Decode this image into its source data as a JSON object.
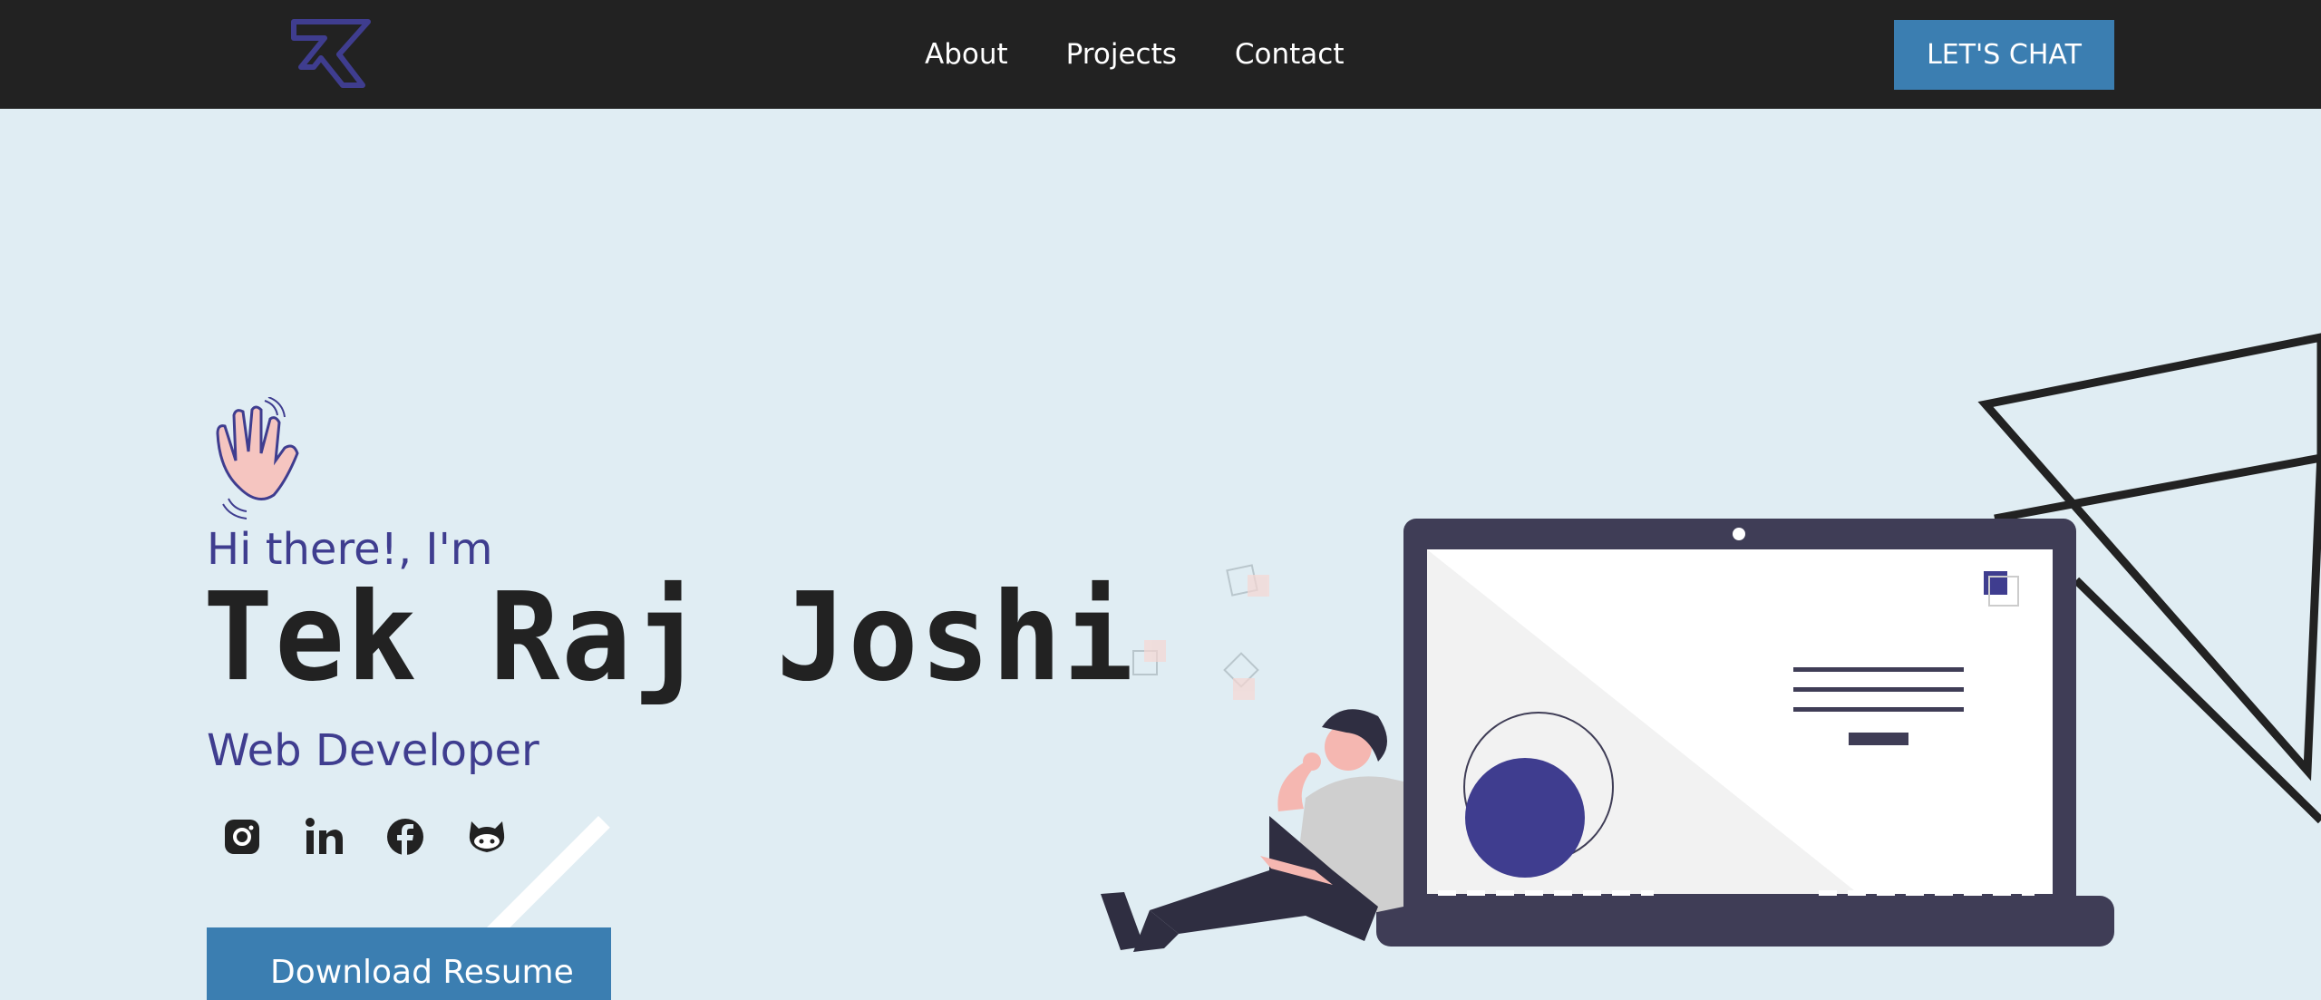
{
  "nav": {
    "logo_icon": "tk-monogram-logo",
    "links": [
      {
        "label": "About"
      },
      {
        "label": "Projects"
      },
      {
        "label": "Contact"
      }
    ],
    "cta_label": "LET'S CHAT"
  },
  "hero": {
    "wave_icon": "waving-hand-icon",
    "greeting": "Hi there!, I'm",
    "name": "Tek Raj Joshi",
    "role": "Web Developer",
    "socials": [
      {
        "icon": "instagram-icon"
      },
      {
        "icon": "linkedin-icon"
      },
      {
        "icon": "facebook-icon"
      },
      {
        "icon": "github-icon"
      }
    ],
    "download_label": "Download Resume"
  },
  "colors": {
    "nav_bg": "#222222",
    "page_bg": "#e0edf3",
    "accent_blue": "#3b7eb1",
    "accent_purple": "#3f3d8f",
    "dark_text": "#222222"
  }
}
